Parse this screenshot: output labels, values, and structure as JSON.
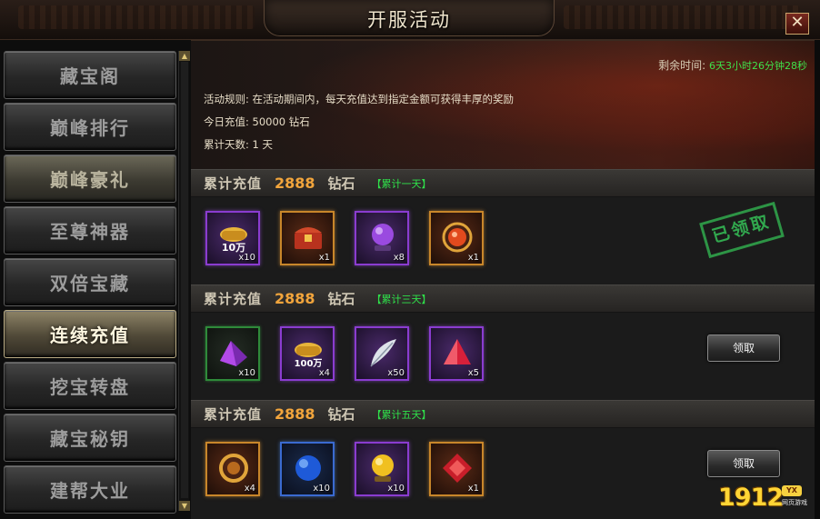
{
  "window": {
    "title": "开服活动",
    "close_label": "✕"
  },
  "sidebar": {
    "items": [
      {
        "label": "藏宝阁",
        "state": "normal"
      },
      {
        "label": "巅峰排行",
        "state": "normal"
      },
      {
        "label": "巅峰豪礼",
        "state": "highlight"
      },
      {
        "label": "至尊神器",
        "state": "normal"
      },
      {
        "label": "双倍宝藏",
        "state": "normal"
      },
      {
        "label": "连续充值",
        "state": "active"
      },
      {
        "label": "挖宝转盘",
        "state": "normal"
      },
      {
        "label": "藏宝秘钥",
        "state": "normal"
      },
      {
        "label": "建帮大业",
        "state": "normal"
      }
    ]
  },
  "banner": {
    "remain_label": "剩余时间:",
    "remain_value": "6天3小时26分钟28秒",
    "rule_label": "活动规则:",
    "rule_text": "在活动期间内，每天充值达到指定金额可获得丰厚的奖励",
    "today_label": "今日充值:",
    "today_value": "50000 钻石",
    "days_label": "累计天数:",
    "days_value": "1 天"
  },
  "tiers": [
    {
      "label": "累计充值",
      "amount": "2888",
      "unit": "钻石",
      "tag": "【累计一天】",
      "claimed_stamp": "已领取",
      "items": [
        {
          "icon": "gold-ingot-10w-icon",
          "text": "10万",
          "count": "x10",
          "frame": "purple"
        },
        {
          "icon": "treasure-chest-icon",
          "count": "x1",
          "frame": "gold"
        },
        {
          "icon": "crystal-ball-icon",
          "count": "x8",
          "frame": "purple"
        },
        {
          "icon": "dragon-orb-icon",
          "count": "x1",
          "frame": "gold"
        }
      ]
    },
    {
      "label": "累计充值",
      "amount": "2888",
      "unit": "钻石",
      "tag": "【累计三天】",
      "button": "领取",
      "items": [
        {
          "icon": "purple-ore-icon",
          "count": "x10",
          "frame": "green"
        },
        {
          "icon": "gold-ingot-100w-icon",
          "text": "100万",
          "count": "x4",
          "frame": "purple"
        },
        {
          "icon": "feather-icon",
          "count": "x50",
          "frame": "purple"
        },
        {
          "icon": "red-gem-triangle-icon",
          "count": "x5",
          "frame": "purple"
        }
      ]
    },
    {
      "label": "累计充值",
      "amount": "2888",
      "unit": "钻石",
      "tag": "【累计五天】",
      "button": "领取",
      "items": [
        {
          "icon": "dragon-ring-icon",
          "count": "x4",
          "frame": "gold"
        },
        {
          "icon": "blue-orb-icon",
          "count": "x10",
          "frame": "blue"
        },
        {
          "icon": "golden-orb-icon",
          "count": "x10",
          "frame": "purple"
        },
        {
          "icon": "red-gem-square-icon",
          "count": "x1",
          "frame": "gold"
        }
      ]
    }
  ],
  "logo": {
    "number": "1912",
    "badge": "YX",
    "sub": "网页游戏"
  }
}
